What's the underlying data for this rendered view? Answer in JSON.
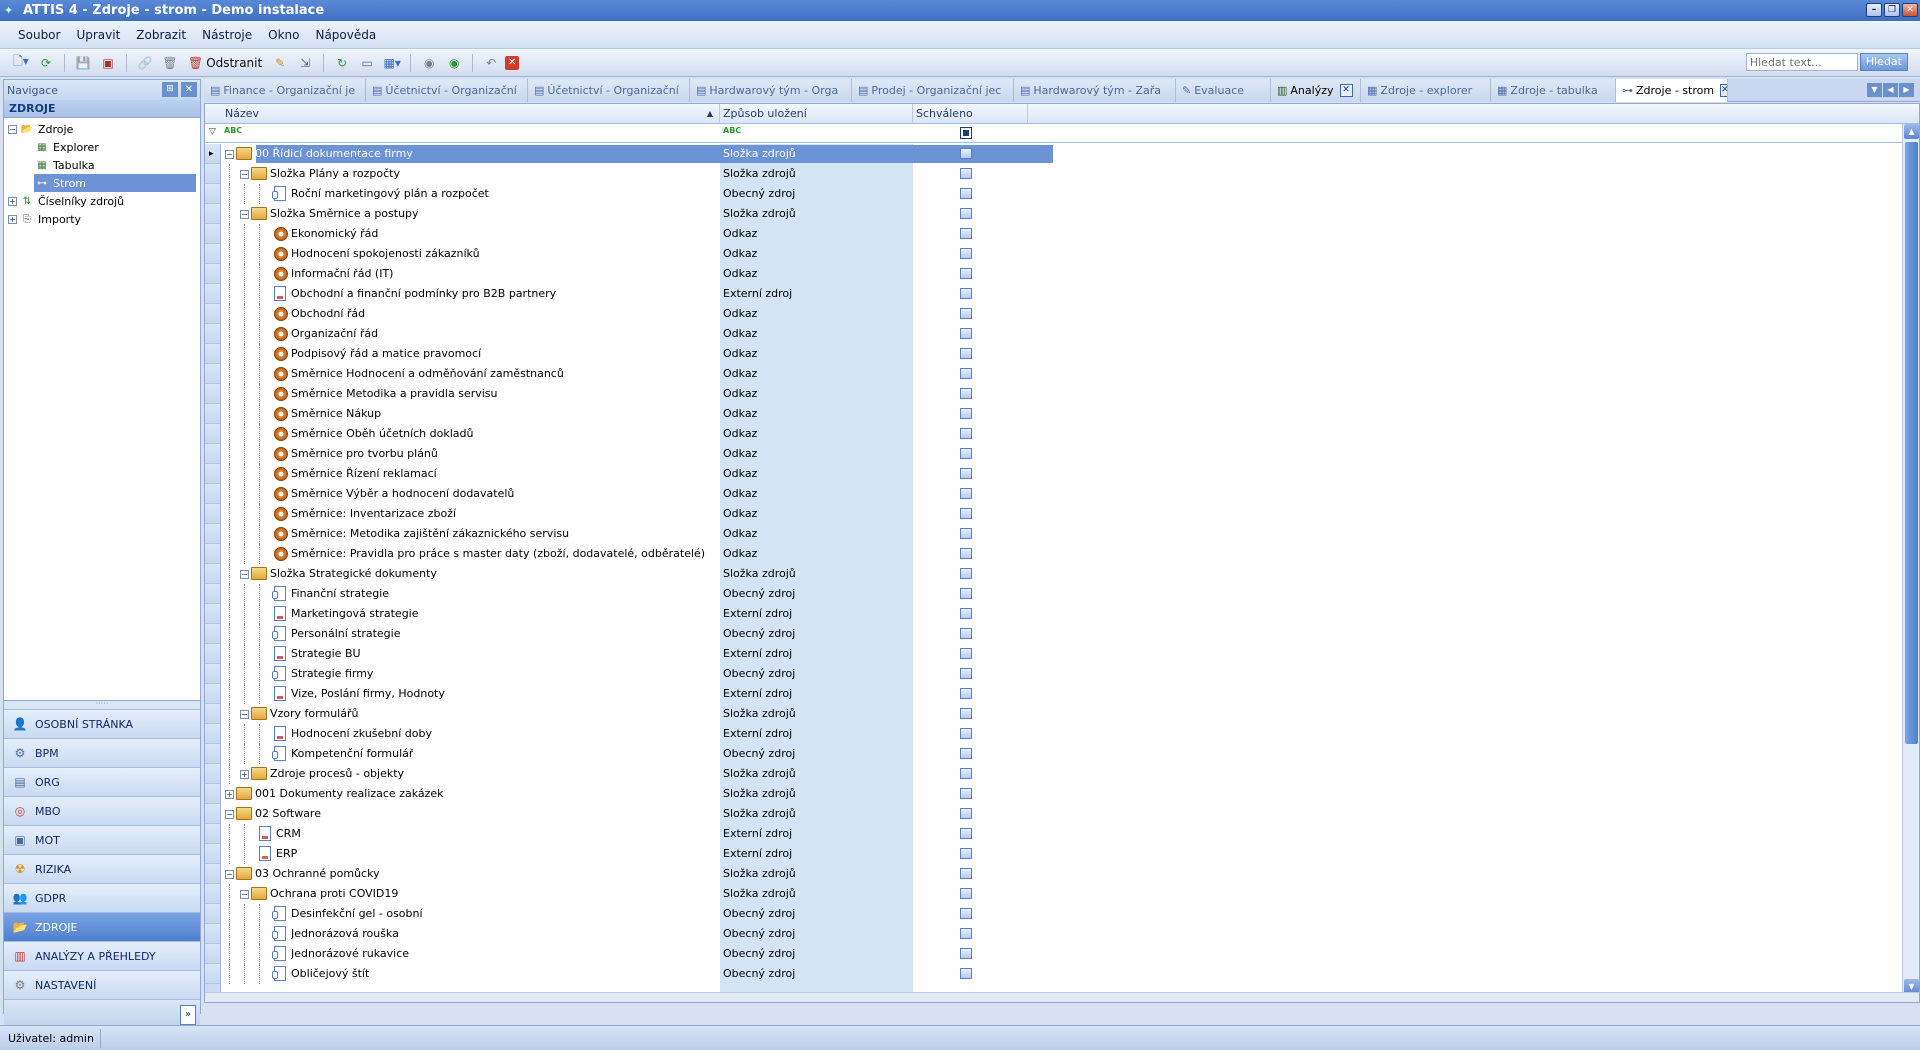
{
  "window": {
    "title": "ATTIS 4 - Zdroje - strom - Demo instalace"
  },
  "menu": [
    "Soubor",
    "Upravit",
    "Zobrazit",
    "Nástroje",
    "Okno",
    "Nápověda"
  ],
  "toolbar": {
    "remove_label": "Odstranit"
  },
  "search": {
    "placeholder": "Hledat text...",
    "button": "Hledat"
  },
  "nav": {
    "header": "Navigace",
    "section": "ZDROJE",
    "tree": [
      {
        "label": "Zdroje",
        "level": 0
      },
      {
        "label": "Explorer",
        "level": 1
      },
      {
        "label": "Tabulka",
        "level": 1
      },
      {
        "label": "Strom",
        "level": 1,
        "selected": true
      },
      {
        "label": "Číselníky zdrojů",
        "level": 0
      },
      {
        "label": "Importy",
        "level": 0
      }
    ],
    "modules": [
      {
        "label": "OSOBNÍ STRÁNKA",
        "icon": "person-icon"
      },
      {
        "label": "BPM",
        "icon": "bpm-icon"
      },
      {
        "label": "ORG",
        "icon": "org-icon"
      },
      {
        "label": "MBO",
        "icon": "mbo-icon"
      },
      {
        "label": "MOT",
        "icon": "mot-icon"
      },
      {
        "label": "RIZIKA",
        "icon": "risk-icon"
      },
      {
        "label": "GDPR",
        "icon": "gdpr-icon"
      },
      {
        "label": "ZDROJE",
        "icon": "folder-icon",
        "active": true
      },
      {
        "label": "ANALÝZY A PŘEHLEDY",
        "icon": "analysis-icon"
      },
      {
        "label": "NASTAVENÍ",
        "icon": "settings-icon"
      }
    ]
  },
  "tabs": [
    {
      "label": "Finance - Organizační je"
    },
    {
      "label": "Účetnictví - Organizační"
    },
    {
      "label": "Účetnictví - Organizační"
    },
    {
      "label": "Hardwarový tým - Orga"
    },
    {
      "label": "Prodej - Organizační jec"
    },
    {
      "label": "Hardwarový tým - Zařa"
    },
    {
      "label": "Evaluace"
    },
    {
      "label": "Analýzy",
      "closable": true
    },
    {
      "label": "Zdroje - explorer"
    },
    {
      "label": "Zdroje - tabulka"
    },
    {
      "label": "Zdroje - strom",
      "active": true,
      "closable": true
    }
  ],
  "grid": {
    "columns": [
      "Název",
      "Způsob uložení",
      "Schváleno"
    ],
    "filter_token": "ABC",
    "rows": [
      {
        "name": "00 Řídicí dokumentace firmy",
        "type": "Složka zdrojů",
        "level": 0,
        "kind": "folder",
        "selected": true
      },
      {
        "name": "Složka Plány a rozpočty",
        "type": "Složka zdrojů",
        "level": 1,
        "kind": "folder"
      },
      {
        "name": "Roční marketingový plán a rozpočet",
        "type": "Obecný zdroj",
        "level": 2,
        "kind": "obec"
      },
      {
        "name": "Složka Směrnice a postupy",
        "type": "Složka zdrojů",
        "level": 1,
        "kind": "folder"
      },
      {
        "name": "Ekonomický řád",
        "type": "Odkaz",
        "level": 2,
        "kind": "link"
      },
      {
        "name": "Hodnocení spokojenosti zákazníků",
        "type": "Odkaz",
        "level": 2,
        "kind": "link"
      },
      {
        "name": "Informační řád (IT)",
        "type": "Odkaz",
        "level": 2,
        "kind": "link"
      },
      {
        "name": "Obchodní a finanční podmínky pro B2B partnery",
        "type": "Externí zdroj",
        "level": 2,
        "kind": "doc"
      },
      {
        "name": "Obchodní řád",
        "type": "Odkaz",
        "level": 2,
        "kind": "link"
      },
      {
        "name": "Organizační řád",
        "type": "Odkaz",
        "level": 2,
        "kind": "link"
      },
      {
        "name": "Podpisový řád a matice pravomocí",
        "type": "Odkaz",
        "level": 2,
        "kind": "link"
      },
      {
        "name": "Směrnice Hodnocení a odměňování zaměstnanců",
        "type": "Odkaz",
        "level": 2,
        "kind": "link"
      },
      {
        "name": "Směrnice Metodika a pravidla servisu",
        "type": "Odkaz",
        "level": 2,
        "kind": "link"
      },
      {
        "name": "Směrnice Nákup",
        "type": "Odkaz",
        "level": 2,
        "kind": "link"
      },
      {
        "name": "Směrnice Oběh účetních dokladů",
        "type": "Odkaz",
        "level": 2,
        "kind": "link"
      },
      {
        "name": "Směrnice pro tvorbu plánů",
        "type": "Odkaz",
        "level": 2,
        "kind": "link"
      },
      {
        "name": "Směrnice Řízení reklamací",
        "type": "Odkaz",
        "level": 2,
        "kind": "link"
      },
      {
        "name": "Směrnice Výběr a hodnocení dodavatelů",
        "type": "Odkaz",
        "level": 2,
        "kind": "link"
      },
      {
        "name": "Směrnice: Inventarizace zboží",
        "type": "Odkaz",
        "level": 2,
        "kind": "link"
      },
      {
        "name": "Směrnice: Metodika zajištění zákaznického servisu",
        "type": "Odkaz",
        "level": 2,
        "kind": "link"
      },
      {
        "name": "Směrnice: Pravidla pro práce s master daty (zboží, dodavatelé, odběratelé)",
        "type": "Odkaz",
        "level": 2,
        "kind": "link"
      },
      {
        "name": "Složka Strategické dokumenty",
        "type": "Složka zdrojů",
        "level": 1,
        "kind": "folder"
      },
      {
        "name": "Finanční strategie",
        "type": "Obecný zdroj",
        "level": 2,
        "kind": "obec"
      },
      {
        "name": "Marketingová strategie",
        "type": "Externí zdroj",
        "level": 2,
        "kind": "doc"
      },
      {
        "name": "Personální strategie",
        "type": "Obecný zdroj",
        "level": 2,
        "kind": "obec"
      },
      {
        "name": "Strategie BU",
        "type": "Externí zdroj",
        "level": 2,
        "kind": "doc"
      },
      {
        "name": "Strategie firmy",
        "type": "Obecný zdroj",
        "level": 2,
        "kind": "obec"
      },
      {
        "name": "Vize, Poslání firmy, Hodnoty",
        "type": "Externí zdroj",
        "level": 2,
        "kind": "doc"
      },
      {
        "name": "Vzory formulářů",
        "type": "Složka zdrojů",
        "level": 1,
        "kind": "folder"
      },
      {
        "name": "Hodnocení zkušební doby",
        "type": "Externí zdroj",
        "level": 2,
        "kind": "doc"
      },
      {
        "name": "Kompetenční formulář",
        "type": "Obecný zdroj",
        "level": 2,
        "kind": "obec"
      },
      {
        "name": "Zdroje procesů - objekty",
        "type": "Složka zdrojů",
        "level": 1,
        "kind": "folder",
        "collapsed": true
      },
      {
        "name": "001 Dokumenty realizace zakázek",
        "type": "Složka zdrojů",
        "level": 0,
        "kind": "folder",
        "collapsed": true
      },
      {
        "name": "02 Software",
        "type": "Složka zdrojů",
        "level": 0,
        "kind": "folder"
      },
      {
        "name": "CRM",
        "type": "Externí zdroj",
        "level": 1,
        "kind": "doc"
      },
      {
        "name": "ERP",
        "type": "Externí zdroj",
        "level": 1,
        "kind": "doc"
      },
      {
        "name": "03 Ochranné pomůcky",
        "type": "Složka zdrojů",
        "level": 0,
        "kind": "folder"
      },
      {
        "name": "Ochrana proti COVID19",
        "type": "Složka zdrojů",
        "level": 1,
        "kind": "folder"
      },
      {
        "name": "Desinfekční gel - osobní",
        "type": "Obecný zdroj",
        "level": 2,
        "kind": "obec"
      },
      {
        "name": "Jednorázová rouška",
        "type": "Obecný zdroj",
        "level": 2,
        "kind": "obec"
      },
      {
        "name": "Jednorázové rukavice",
        "type": "Obecný zdroj",
        "level": 2,
        "kind": "obec"
      },
      {
        "name": "Obličejový štít",
        "type": "Obecný zdroj",
        "level": 2,
        "kind": "obec"
      }
    ]
  },
  "status": {
    "user": "Uživatel: admin"
  }
}
